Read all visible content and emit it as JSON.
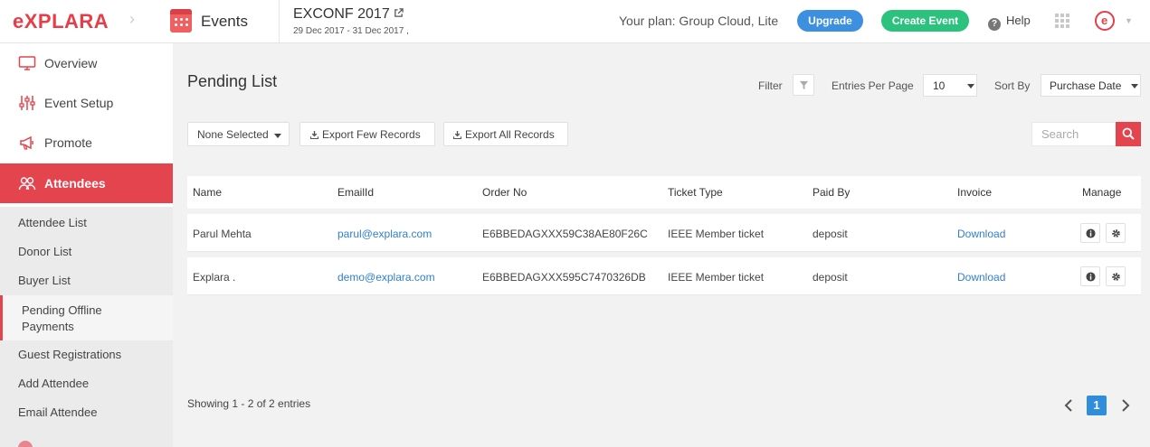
{
  "header": {
    "logo": "eXPLARA",
    "app_title": "Events",
    "event_name": "EXCONF 2017",
    "event_dates": "29 Dec 2017 - 31 Dec 2017 ,",
    "plan_text": "Your plan: Group Cloud, Lite",
    "upgrade_label": "Upgrade",
    "create_event_label": "Create Event",
    "help_label": "Help",
    "colors": {
      "brand": "#e83d48",
      "upgrade": "#3d8fe0",
      "create": "#2bc27d"
    }
  },
  "sidebar": {
    "items": [
      {
        "label": "Overview",
        "icon": "monitor-icon"
      },
      {
        "label": "Event Setup",
        "icon": "sliders-icon"
      },
      {
        "label": "Promote",
        "icon": "megaphone-icon"
      },
      {
        "label": "Attendees",
        "icon": "users-icon",
        "active": true
      }
    ],
    "submenu": [
      {
        "label": "Attendee List"
      },
      {
        "label": "Donor List"
      },
      {
        "label": "Buyer List"
      },
      {
        "label": "Pending Offline Payments",
        "current": true
      },
      {
        "label": "Guest Registrations"
      },
      {
        "label": "Add Attendee"
      },
      {
        "label": "Email Attendee"
      }
    ]
  },
  "main": {
    "title": "Pending List",
    "filter_label": "Filter",
    "entries_label": "Entries Per Page",
    "entries_value": "10",
    "sort_label": "Sort By",
    "sort_value": "Purchase Date",
    "selection_label": "None Selected",
    "export_few_label": "Export Few Records",
    "export_all_label": "Export All Records",
    "search_placeholder": "Search",
    "columns": [
      "Name",
      "EmailId",
      "Order No",
      "Ticket Type",
      "Paid By",
      "Invoice",
      "Manage"
    ],
    "rows": [
      {
        "name": "Parul Mehta",
        "email": "parul@explara.com",
        "order_no": "E6BBEDAGXXX59C38AE80F26C",
        "ticket_type": "IEEE Member ticket",
        "paid_by": "deposit",
        "invoice": "Download"
      },
      {
        "name": "Explara .",
        "email": "demo@explara.com",
        "order_no": "E6BBEDAGXXX595C7470326DB",
        "ticket_type": "IEEE Member ticket",
        "paid_by": "deposit",
        "invoice": "Download"
      }
    ],
    "showing_text": "Showing 1 - 2 of 2 entries",
    "current_page": "1"
  }
}
